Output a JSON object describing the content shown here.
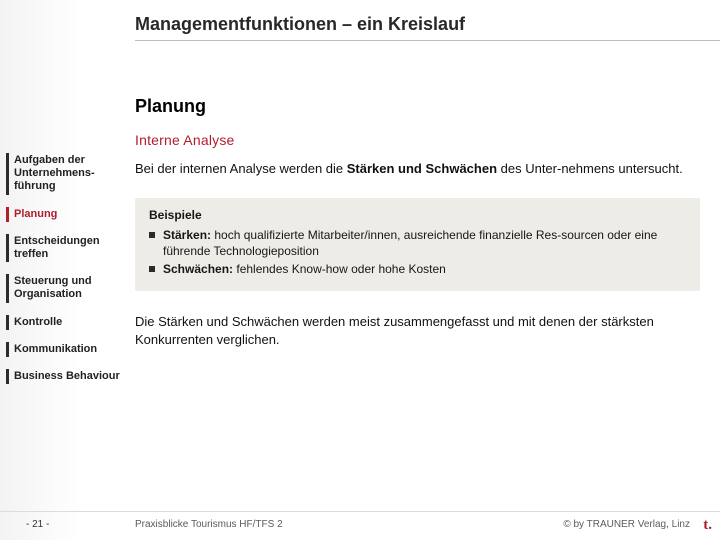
{
  "header": {
    "title": "Managementfunktionen – ein Kreislauf"
  },
  "section": {
    "title": "Planung",
    "subtitle": "Interne Analyse"
  },
  "nav": {
    "items": [
      {
        "label": "Aufgaben der Unternehmens-führung",
        "active": false
      },
      {
        "label": "Planung",
        "active": true
      },
      {
        "label": "Entscheidungen treffen",
        "active": false
      },
      {
        "label": "Steuerung und Organisation",
        "active": false
      },
      {
        "label": "Kontrolle",
        "active": false
      },
      {
        "label": "Kommunikation",
        "active": false
      },
      {
        "label": "Business Behaviour",
        "active": false
      }
    ]
  },
  "body": {
    "para1_pre": "Bei der internen Analyse werden die ",
    "para1_bold": "Stärken und Schwächen",
    "para1_post": " des Unter-nehmens untersucht.",
    "example": {
      "header": "Beispiele",
      "rows": [
        {
          "label": "Stärken:",
          "text": " hoch qualifizierte Mitarbeiter/innen, ausreichende finanzielle Res-sourcen oder eine führende Technologieposition"
        },
        {
          "label": "Schwächen:",
          "text": " fehlendes Know-how oder hohe Kosten"
        }
      ]
    },
    "para2": "Die Stärken und Schwächen werden meist zusammengefasst und mit denen der stärksten Konkurrenten verglichen."
  },
  "footer": {
    "page": "- 21 -",
    "left": "Praxisblicke Tourismus HF/TFS 2",
    "right": "© by TRAUNER Verlag, Linz"
  },
  "colors": {
    "accent": "#b01e2e",
    "example_bg": "#eeece7"
  }
}
